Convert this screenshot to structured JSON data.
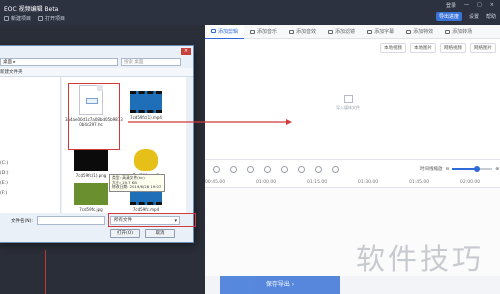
{
  "app": {
    "logo": "EOC 视频编辑 Beta",
    "menu": [
      {
        "label": "新建项目"
      },
      {
        "label": "打开项目"
      }
    ],
    "top_right": [
      "登录",
      "一",
      "□",
      "×"
    ],
    "toolbar_right": [
      "导出进度",
      "设置",
      "帮助"
    ]
  },
  "media_tabs": [
    "添加剪辑",
    "添加音乐",
    "添加音效",
    "添加滤镜",
    "添加字幕",
    "添加特效",
    "添加转场",
    "添加图片",
    "添加配音"
  ],
  "media_buttons": [
    "本地视频",
    "本地图片",
    "网络视频",
    "网络图片"
  ],
  "import_hint": "导入媒体文件",
  "timeline": {
    "zoom_label": "时间线缩放",
    "zoom_level": 0.62,
    "ruler": [
      "00:45.00",
      "01:00.00",
      "01:15.00",
      "01:30.00",
      "01:45.00",
      "02:00.00"
    ]
  },
  "export_label": "保存导出 ›",
  "watermark": "软件技巧",
  "dialog": {
    "close": "×",
    "address": "桌面  ▸",
    "search_placeholder": "搜索 桌面",
    "toolbar": "新建文件夹",
    "sidebar": [
      "",
      "",
      "",
      "(C:)",
      "(D:)",
      "(E:)",
      "(F:)"
    ],
    "files": [
      {
        "name": "3a4ae00d1c7a08bd05b9873 0b4c297.hc"
      },
      {
        "name": "7cd59fc(1).mp4"
      },
      {
        "name": "7cd59fc(1).png"
      },
      {
        "name": "7cd59fc.mp3"
      },
      {
        "name": "7cd59fc.jpg"
      },
      {
        "name": "7cd59fc.mp4"
      }
    ],
    "tooltip": [
      "类型: 高清文件(hc)",
      "大小: 19.7 KB",
      "修改日期: 2019/8/28 19:07"
    ],
    "filename_label": "文件名(N):",
    "filter": "所有文件",
    "open_button": "打开(O)",
    "cancel_button": "取消"
  }
}
